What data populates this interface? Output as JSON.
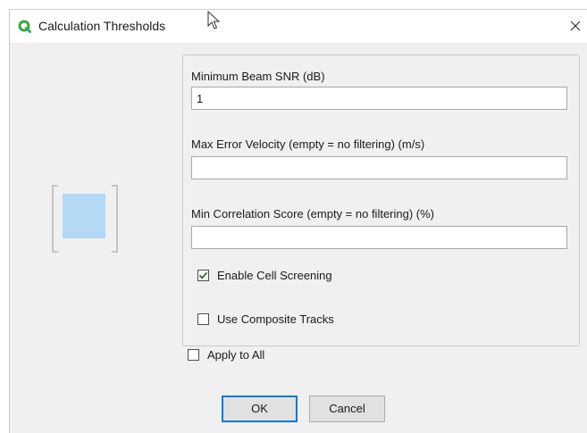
{
  "window": {
    "title": "Calculation Thresholds",
    "app_icon": "app-logo-icon",
    "close_icon": "close-icon"
  },
  "fields": {
    "min_beam_snr": {
      "label": "Minimum Beam SNR (dB)",
      "value": "1"
    },
    "max_error_velocity": {
      "label": "Max Error Velocity (empty = no filtering) (m/s)",
      "value": ""
    },
    "min_correlation_score": {
      "label": "Min Correlation Score (empty = no filtering) (%)",
      "value": ""
    }
  },
  "checkboxes": {
    "enable_cell_screening": {
      "label": "Enable Cell Screening",
      "checked": true
    },
    "use_composite_tracks": {
      "label": "Use Composite Tracks",
      "checked": false
    },
    "apply_to_all": {
      "label": "Apply to All",
      "checked": false
    }
  },
  "buttons": {
    "ok": "OK",
    "cancel": "Cancel"
  },
  "colors": {
    "accent": "#0078d7",
    "check_mark": "#2e6b2e",
    "image_fill": "#b3d9f5",
    "app_icon": "#3aa64a"
  }
}
